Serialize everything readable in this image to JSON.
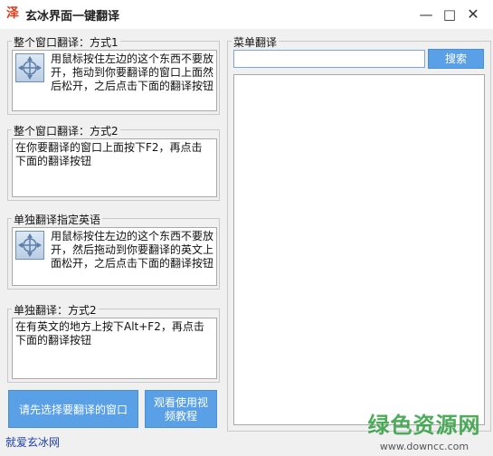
{
  "window": {
    "icon_char": "泽",
    "title": "玄冰界面一键翻译",
    "minimize": "—",
    "maximize": "□",
    "close": "✕"
  },
  "groups": {
    "g1": {
      "legend": "整个窗口翻译：方式1",
      "text": "用鼠标按住左边的这个东西不要放开，拖动到你要翻译的窗口上面然后松开，之后点击下面的翻译按钮"
    },
    "g2": {
      "legend": "整个窗口翻译：方式2",
      "text": "在你要翻译的窗口上面按下F2，再点击下面的翻译按钮"
    },
    "g3": {
      "legend": "单独翻译指定英语",
      "text": "用鼠标按住左边的这个东西不要放开，然后拖动到你要翻译的英文上面松开，之后点击下面的翻译按钮"
    },
    "g4": {
      "legend": "单独翻译：方式2",
      "text": "在有英文的地方上按下Alt+F2，再点击下面的翻译按钮"
    },
    "menu": {
      "legend": "菜单翻译"
    }
  },
  "buttons": {
    "select_window": "请先选择要翻译的窗口",
    "watch_video": "观看使用视频教程",
    "search": "搜索"
  },
  "search": {
    "value": ""
  },
  "footer": {
    "link": "就爱玄冰网"
  },
  "watermark": {
    "main": "绿色资源网",
    "url": "www.downcc.com"
  },
  "colors": {
    "accent": "#5aa0e6",
    "footer_link": "#1a3fae",
    "watermark": "#2f9e3e"
  }
}
